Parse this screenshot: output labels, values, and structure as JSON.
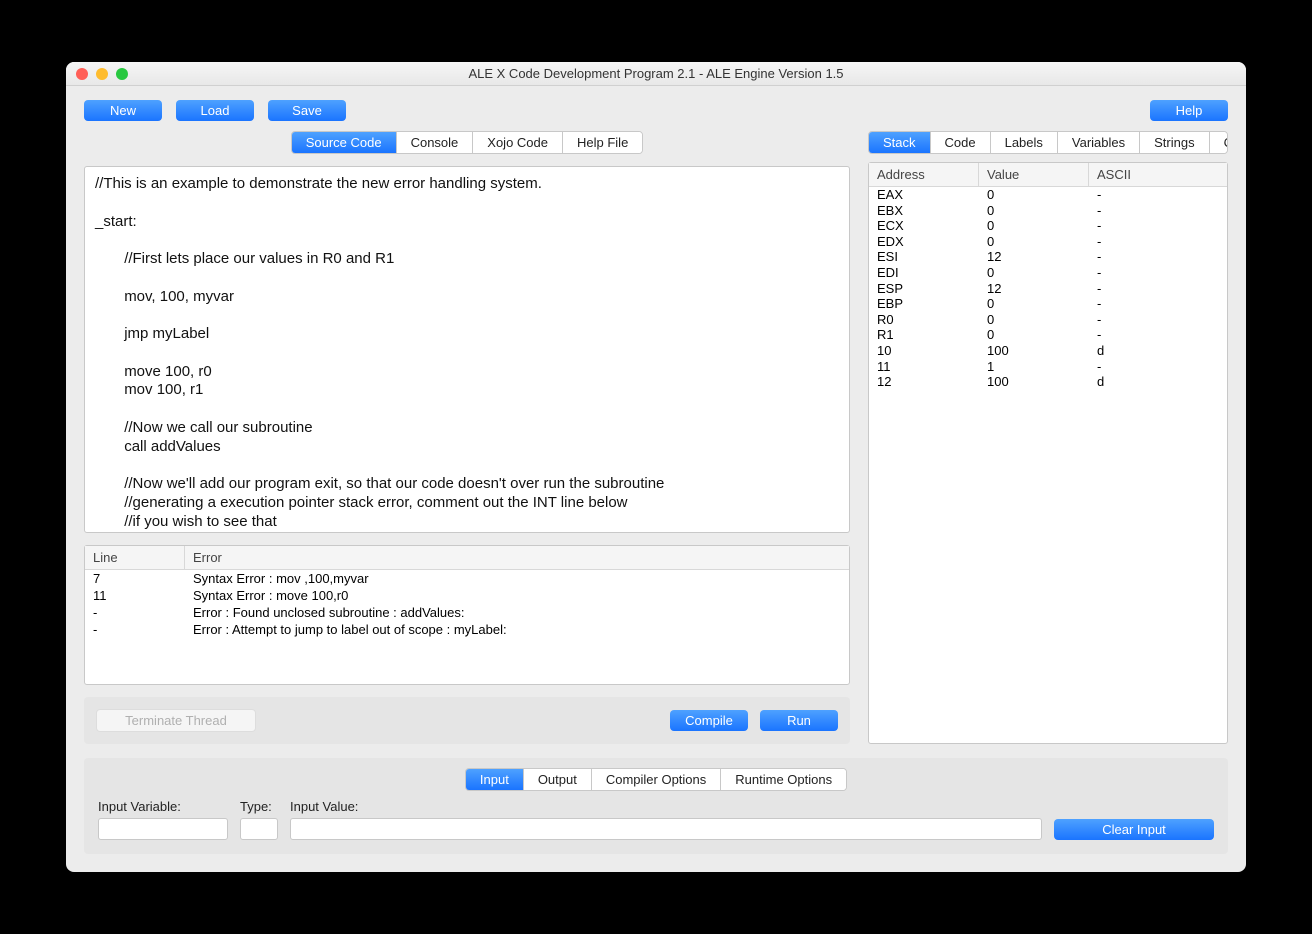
{
  "window": {
    "title": "ALE X Code Development Program 2.1 - ALE Engine Version 1.5"
  },
  "toolbar": {
    "new": "New",
    "load": "Load",
    "save": "Save",
    "help": "Help"
  },
  "leftTabs": {
    "items": [
      "Source Code",
      "Console",
      "Xojo Code",
      "Help File"
    ],
    "active": 0
  },
  "rightTabs": {
    "items": [
      "Stack",
      "Code",
      "Labels",
      "Variables",
      "Strings",
      "Constants"
    ],
    "active": 0
  },
  "code": "//This is an example to demonstrate the new error handling system.\n\n_start:\n\n       //First lets place our values in R0 and R1\n\n       mov, 100, myvar\n\n       jmp myLabel\n\n       move 100, r0\n       mov 100, r1\n\n       //Now we call our subroutine\n       call addValues\n\n       //Now we'll add our program exit, so that our code doesn't over run the subroutine\n       //generating a execution pointer stack error, comment out the INT line below\n       //if you wish to see that",
  "errors": {
    "headers": {
      "line": "Line",
      "error": "Error"
    },
    "rows": [
      {
        "line": "7",
        "error": "Syntax Error : mov ,100,myvar"
      },
      {
        "line": "11",
        "error": "Syntax Error : move 100,r0"
      },
      {
        "line": "-",
        "error": "Error : Found unclosed subroutine : addValues:"
      },
      {
        "line": "-",
        "error": "Error : Attempt to jump to label out of scope : myLabel:"
      }
    ]
  },
  "actions": {
    "terminate": "Terminate Thread",
    "compile": "Compile",
    "run": "Run"
  },
  "stack": {
    "headers": {
      "address": "Address",
      "value": "Value",
      "ascii": "ASCII"
    },
    "rows": [
      {
        "address": "EAX",
        "value": "0",
        "ascii": "-"
      },
      {
        "address": "EBX",
        "value": "0",
        "ascii": "-"
      },
      {
        "address": "ECX",
        "value": "0",
        "ascii": "-"
      },
      {
        "address": "EDX",
        "value": "0",
        "ascii": "-"
      },
      {
        "address": "ESI",
        "value": "12",
        "ascii": "-"
      },
      {
        "address": "EDI",
        "value": "0",
        "ascii": "-"
      },
      {
        "address": "ESP",
        "value": "12",
        "ascii": "-"
      },
      {
        "address": "EBP",
        "value": "0",
        "ascii": "-"
      },
      {
        "address": "R0",
        "value": "0",
        "ascii": "-"
      },
      {
        "address": "R1",
        "value": "0",
        "ascii": "-"
      },
      {
        "address": "10",
        "value": "100",
        "ascii": "d"
      },
      {
        "address": "11",
        "value": "1",
        "ascii": "-"
      },
      {
        "address": "12",
        "value": "100",
        "ascii": "d"
      }
    ]
  },
  "bottomTabs": {
    "items": [
      "Input",
      "Output",
      "Compiler Options",
      "Runtime Options"
    ],
    "active": 0
  },
  "inputPanel": {
    "varLabel": "Input Variable:",
    "typeLabel": "Type:",
    "valueLabel": "Input Value:",
    "clear": "Clear Input"
  }
}
